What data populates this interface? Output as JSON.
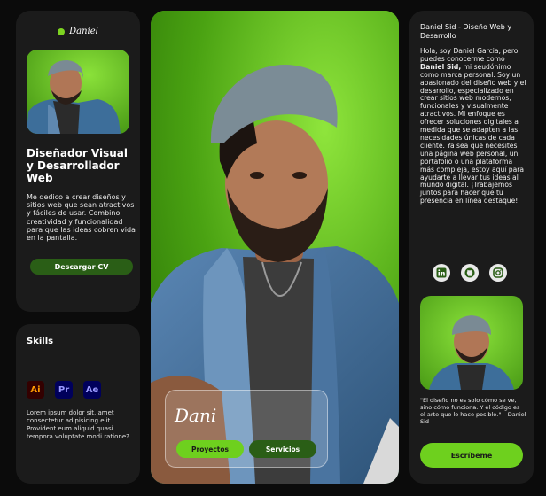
{
  "brand": {
    "logo_text": "Daniel",
    "accent": "#6ed01e",
    "dark_green": "#2a5e16"
  },
  "profile": {
    "title": "Diseñador Visual y Desarrollador Web",
    "description": "Me dedico a crear diseños y sitios web que sean atractivos y fáciles de usar. Combino creatividad y funcionalidad para que las ideas cobren vida en la pantalla.",
    "cv_button": "Descargar CV"
  },
  "skills": {
    "title": "Skills",
    "icons": [
      {
        "label": "Ai",
        "icon": "adobe-illustrator-icon"
      },
      {
        "label": "Pr",
        "icon": "adobe-premiere-icon"
      },
      {
        "label": "Ae",
        "icon": "adobe-after-effects-icon"
      }
    ],
    "text": "Lorem ipsum dolor sit, amet consectetur adipisicing elit. Provident eum aliquid quasi tempora voluptate modi ratione?"
  },
  "hero": {
    "name": "Dani",
    "projects_button": "Proyectos",
    "services_button": "Servicios"
  },
  "about": {
    "title": "Daniel Sid - Diseño Web y Desarrollo",
    "text_before": "Hola, soy Daniel Garcia, pero puedes conocerme como ",
    "text_bold": "Daniel Sid,",
    "text_after": " mi seudónimo como marca personal. Soy un apasionado del diseño web y el desarrollo, especializado en crear sitios web modernos, funcionales y visualmente atractivos. Mi enfoque es ofrecer soluciones digitales a medida que se adapten a las necesidades únicas de cada cliente. Ya sea que necesites una página web personal, un portafolio o una plataforma más compleja, estoy aquí para ayudarte a llevar tus ideas al mundo digital. ¡Trabajemos juntos para hacer que tu presencia en línea destaque!",
    "socials": [
      "linkedin-icon",
      "github-icon",
      "instagram-icon"
    ],
    "quote": "\"El diseño no es solo cómo se ve, sino cómo funciona. Y el código es el arte que lo hace posible.\" – Daniel Sid",
    "contact_button": "Escríbeme"
  }
}
